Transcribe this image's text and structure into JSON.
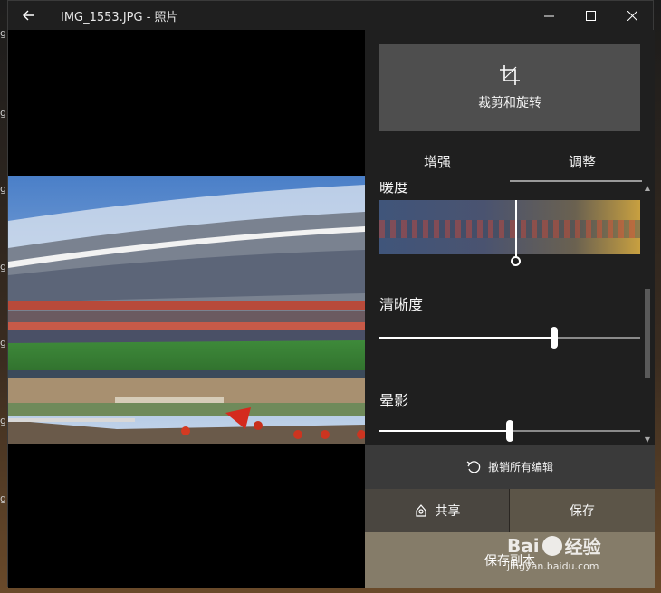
{
  "window": {
    "title": "IMG_1553.JPG - 照片"
  },
  "desktop": {
    "edge_letters": [
      "g",
      "g",
      "g",
      "g",
      "g",
      "g",
      "g"
    ]
  },
  "panel": {
    "crop_rotate_label": "裁剪和旋转",
    "tabs": [
      {
        "label": "增强",
        "active": false
      },
      {
        "label": "调整",
        "active": true
      }
    ],
    "adjust": {
      "warmth_label": "暖度",
      "warmth_value": 0.525,
      "clarity_label": "清晰度",
      "clarity_value": 0.67,
      "vignette_label": "晕影",
      "vignette_value": 0.5
    },
    "undo_label": "撤销所有编辑",
    "share_label": "共享",
    "save_label": "保存",
    "save_copy_label": "保存副本"
  },
  "watermark": {
    "brand_left": "Bai",
    "brand_right": "经验",
    "url": "jingyan.baidu.com"
  },
  "colors": {
    "panel_bg": "#1f1f1f",
    "crop_bg": "#4e4e4e",
    "undo_bg": "#3a3a3a",
    "save_copy_bg": "#857c69"
  }
}
